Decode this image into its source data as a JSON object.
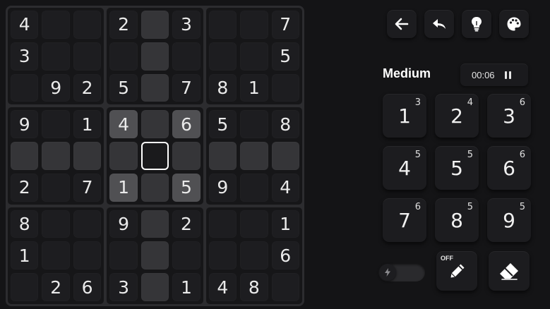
{
  "grid": [
    [
      "4",
      "",
      "",
      "2",
      "",
      "3",
      "",
      "",
      "7"
    ],
    [
      "3",
      "",
      "",
      "",
      "",
      "",
      "",
      "",
      "5"
    ],
    [
      "",
      "9",
      "2",
      "5",
      "",
      "7",
      "8",
      "1",
      ""
    ],
    [
      "9",
      "",
      "1",
      "4",
      "",
      "6",
      "5",
      "",
      "8"
    ],
    [
      "",
      "",
      "",
      "",
      "",
      "",
      "",
      "",
      ""
    ],
    [
      "2",
      "",
      "7",
      "1",
      "",
      "5",
      "9",
      "",
      "4"
    ],
    [
      "8",
      "",
      "",
      "9",
      "",
      "2",
      "",
      "",
      "1"
    ],
    [
      "1",
      "",
      "",
      "",
      "",
      "",
      "",
      "",
      "6"
    ],
    [
      "",
      "2",
      "6",
      "3",
      "",
      "1",
      "4",
      "8",
      ""
    ]
  ],
  "selected_cell": {
    "row": 4,
    "col": 4
  },
  "toolbar": {
    "back_icon": "arrow-left-icon",
    "undo_icon": "undo-icon",
    "hint_icon": "lightbulb-icon",
    "theme_icon": "palette-icon"
  },
  "difficulty": "Medium",
  "timer": "00:06",
  "numpad": [
    {
      "digit": "1",
      "count": "3"
    },
    {
      "digit": "2",
      "count": "4"
    },
    {
      "digit": "3",
      "count": "6"
    },
    {
      "digit": "4",
      "count": "5"
    },
    {
      "digit": "5",
      "count": "5"
    },
    {
      "digit": "6",
      "count": "6"
    },
    {
      "digit": "7",
      "count": "6"
    },
    {
      "digit": "8",
      "count": "5"
    },
    {
      "digit": "9",
      "count": "5"
    }
  ],
  "notes_mode": {
    "label": "OFF",
    "icon": "pencil-icon"
  },
  "erase_icon": "eraser-icon",
  "fast_mode_icon": "lightning-icon",
  "colors": {
    "background": "#141416",
    "selection": "#ffffff",
    "highlight": "#353538",
    "same_value": "#505053"
  }
}
